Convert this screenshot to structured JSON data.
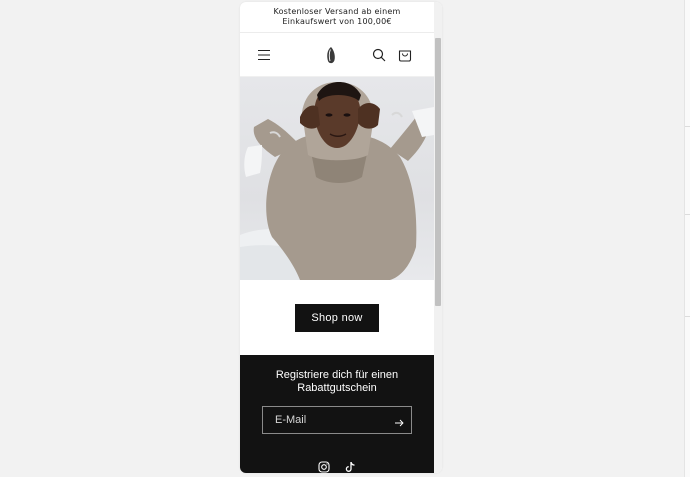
{
  "announcement": {
    "text": "Kostenloser Versand ab einem Einkaufswert von 100,00€"
  },
  "header": {
    "menu_icon": "hamburger-menu-icon",
    "logo_icon": "brand-logo-icon",
    "search_icon": "search-icon",
    "cart_icon": "shopping-bag-icon"
  },
  "hero": {
    "image": "model-in-beige-hoodie-photo"
  },
  "cta": {
    "label": "Shop now"
  },
  "newsletter": {
    "title": "Registriere dich für einen Rabattgutschein",
    "email_placeholder": "E-Mail",
    "submit_icon": "arrow-right-icon"
  },
  "social": {
    "instagram_icon": "instagram-icon",
    "tiktok_icon": "tiktok-icon"
  },
  "colors": {
    "dark": "#121212",
    "page_bg": "#f2f2f2",
    "scroll_thumb": "#c1c1c1"
  }
}
